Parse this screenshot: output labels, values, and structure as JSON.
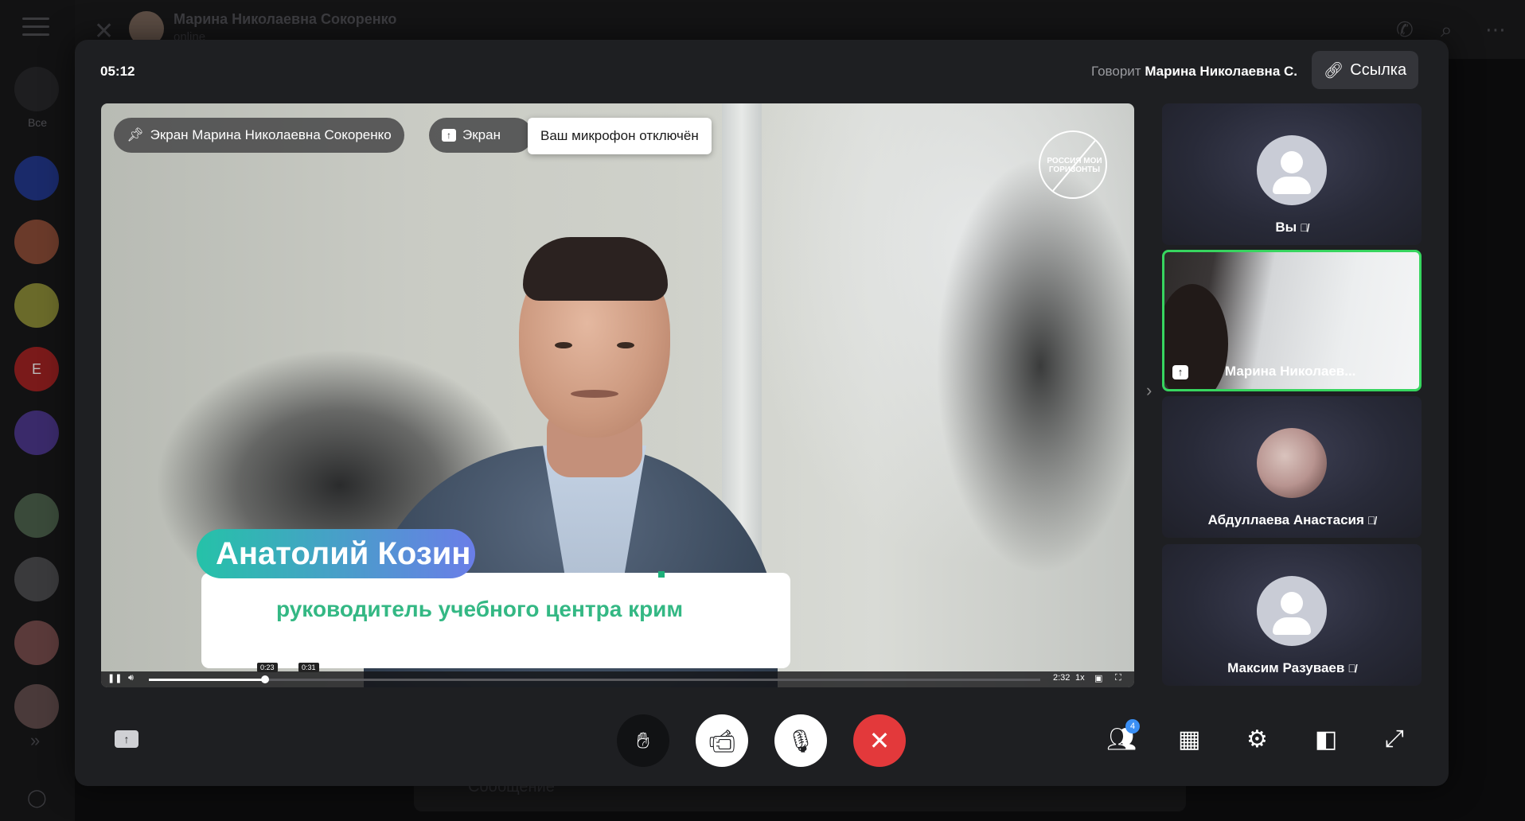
{
  "background_chat": {
    "contact_name": "Марина Николаевна Сокоренко",
    "contact_status": "online",
    "folder_label": "Все",
    "chat_avatar_letter": "E",
    "compose_placeholder": "Сообщение"
  },
  "call": {
    "timer": "05:12",
    "speaking_prefix": "Говорит",
    "speaking_name": "Марина Николаевна С.",
    "link_button": "Ссылка",
    "screen_pill_label": "Экран Марина Николаевна Сокоренко",
    "screen_toggle_label": "Экран",
    "mic_tooltip": "Ваш микрофон отключён",
    "video": {
      "logo_text_line1": "РОССИЯ МОИ",
      "logo_text_line2": "ГОРИЗОНТЫ",
      "name_tag": "Анатолий Козин",
      "role_text": "руководитель учебного центра крим",
      "player": {
        "elapsed_tip": "0:23",
        "hover_tip": "0:31",
        "duration": "2:32",
        "speed": "1x",
        "progress_fraction": 0.13
      }
    },
    "participants": [
      {
        "name": "Вы",
        "muted": true
      },
      {
        "name": "Марина Николаев...",
        "muted": false
      },
      {
        "name": "Абдуллаева Анастасия",
        "muted": true
      },
      {
        "name": "Максим Разуваев",
        "muted": true
      }
    ],
    "participants_count": "4"
  },
  "colors": {
    "active_speaker_border": "#37d55f",
    "end_call": "#e3393b",
    "badge": "#3a8ff5"
  }
}
